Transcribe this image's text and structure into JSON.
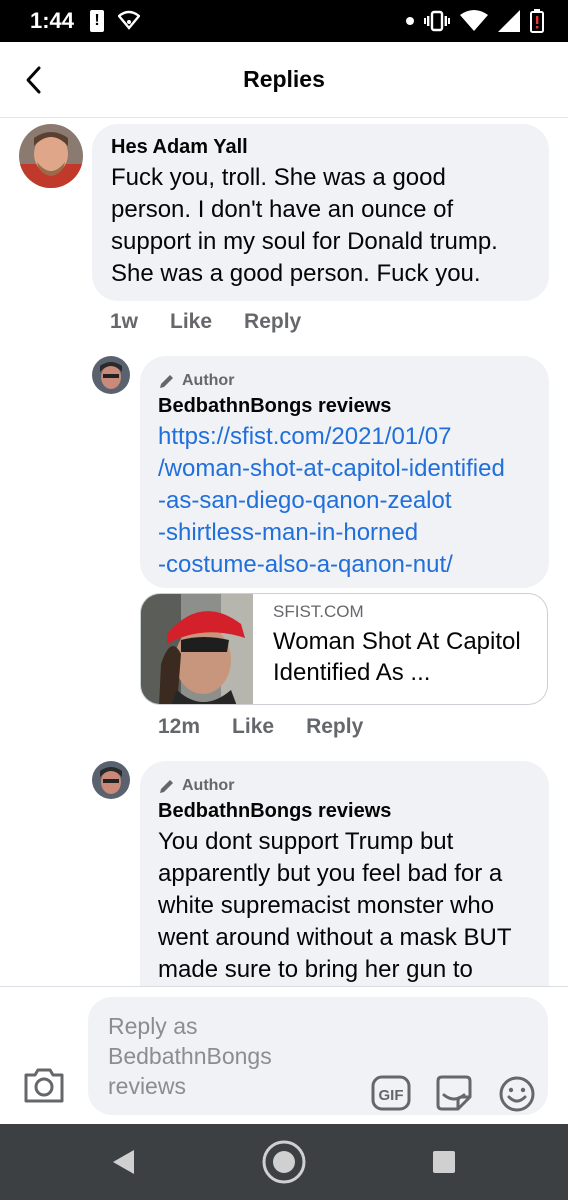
{
  "status": {
    "time": "1:44",
    "alert": "!"
  },
  "header": {
    "title": "Replies"
  },
  "comments": [
    {
      "author": "Hes Adam Yall",
      "text": "Fuck you, troll. She was a good person. I don't have an ounce of support in my soul for Donald trump. She was a good person. Fuck you.",
      "time": "1w",
      "like": "Like",
      "reply": "Reply"
    },
    {
      "badge": "Author",
      "author": "BedbathnBongs reviews",
      "link_lines": [
        "https://sfist.com/2021/01/07",
        "/woman-shot-at-capitol-identified",
        "-as-san-diego-qanon-zealot",
        "-shirtless-man-in-horned",
        "-costume-also-a-qanon-nut/"
      ],
      "preview": {
        "domain": "SFIST.COM",
        "title": "Woman Shot At Capitol Identified As ..."
      },
      "time": "12m",
      "like": "Like",
      "reply": "Reply"
    },
    {
      "badge": "Author",
      "author": "BedbathnBongs reviews",
      "text": "You dont support Trump but apparently but you feel bad for a white supremacist monster who went around without a mask BUT made sure to bring her gun to"
    }
  ],
  "composer": {
    "placeholder": "Reply as BedbathnBongs reviews",
    "gif_label": "GIF"
  },
  "colors": {
    "link": "#216fdb",
    "bubble": "#f0f2f5",
    "secondary_text": "#65676b",
    "nav_bar": "#3c4043"
  }
}
